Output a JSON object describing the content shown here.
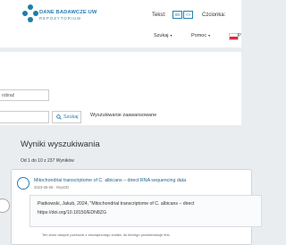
{
  "header": {
    "logo_title": "DANE BADAWCZE UW",
    "logo_subtitle": "REPOZYTORIUM",
    "text_size_label": "Tekst:",
    "text_size_btn1": "80",
    "text_size_btn2": "<>",
    "contrast_label": "Czcionka:"
  },
  "nav": {
    "items": [
      {
        "label": "Szukaj"
      },
      {
        "label": "Pomoc"
      }
    ],
    "language_fragment": "P"
  },
  "search": {
    "input_fragment": "robraź",
    "button_label": "Szukaj",
    "advanced_label": "Wyszukiwanie zaawansowane"
  },
  "results": {
    "title": "Wyniki wyszukiwania",
    "count": "Od 1 do 10 z 237 Wyników",
    "items": [
      {
        "title": "Mitochondrial transcriptome of C. albicans – direct RNA sequencing data",
        "meta": "2023-05-08 · RepOD",
        "citation_line1": "Piatkowski, Jakub, 2024, \"Mitochondrial transcriptome of C. albicans – direct",
        "citation_line2": "https://doi.org/10.18150/EDN8ZG",
        "note": "Ten zbiór danych pochodzi z zewnętrznego źródła, do którego przekierowuje link."
      }
    ]
  },
  "colors": {
    "accent": "#2a7fb0",
    "link": "#1f5f8b",
    "flag_red": "#d92d3a",
    "background": "#eaedf0"
  }
}
